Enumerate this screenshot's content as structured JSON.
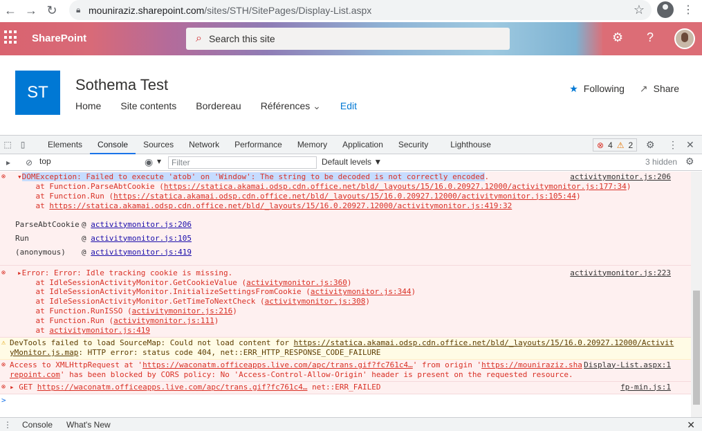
{
  "browser": {
    "url_host": "mouniraziz.sharepoint.com",
    "url_path": "/sites/STH/SitePages/Display-List.aspx",
    "back_icon": "←",
    "forward_icon": "→",
    "reload_icon": "↻",
    "star_icon": "☆",
    "menu_icon": "⋮"
  },
  "suitebar": {
    "brand": "SharePoint",
    "search_placeholder": "Search this site",
    "settings_icon": "⚙",
    "help_icon": "?"
  },
  "site": {
    "logo_text": "ST",
    "title": "Sothema Test",
    "nav": [
      "Home",
      "Site contents",
      "Bordereau",
      "Références",
      "Edit"
    ],
    "following_label": "Following",
    "share_label": "Share"
  },
  "devtools": {
    "tabs": [
      "Elements",
      "Console",
      "Sources",
      "Network",
      "Performance",
      "Memory",
      "Application",
      "Security",
      "Lighthouse"
    ],
    "active_tab": "Console",
    "error_count": "4",
    "warning_count": "2",
    "context": "top",
    "filter_placeholder": "Filter",
    "levels": "Default levels ▼",
    "hidden": "3 hidden",
    "drawer_tabs": [
      "Console",
      "What's New"
    ]
  },
  "console": {
    "m1": {
      "head_pre": "",
      "head_selected": "DOMException: Failed to execute 'atob' on 'Window': The string to be decoded is not correctly encoded",
      "head_post": ".",
      "source": "activitymonitor.js:206",
      "s1_pre": "    at Function.ParseAbtCookie (",
      "s1_link": "https://statica.akamai.odsp.cdn.office.net/bld/_layouts/15/16.0.20927.12000/activitymonitor.js:177:34",
      "s1_post": ")",
      "s2_pre": "    at Function.Run (",
      "s2_link": "https://statica.akamai.odsp.cdn.office.net/bld/_layouts/15/16.0.20927.12000/activitymonitor.js:105:44",
      "s2_post": ")",
      "s3_pre": "    at ",
      "s3_link": "https://statica.akamai.odsp.cdn.office.net/bld/_layouts/15/16.0.20927.12000/activitymonitor.js:419:32",
      "stack_rows": [
        {
          "fn": "ParseAbtCookie",
          "at": "@ ",
          "link": "activitymonitor.js:206"
        },
        {
          "fn": "Run",
          "at": "@ ",
          "link": "activitymonitor.js:105"
        },
        {
          "fn": "(anonymous)",
          "at": "@ ",
          "link": "activitymonitor.js:419"
        }
      ]
    },
    "m2": {
      "head": "Error: Error: Idle tracking cookie is missing.",
      "source": "activitymonitor.js:223",
      "lines": [
        {
          "pre": "    at IdleSessionActivityMonitor.GetCookieValue (",
          "link": "activitymonitor.js:360",
          "post": ")"
        },
        {
          "pre": "    at IdleSessionActivityMonitor.InitializeSettingsFromCookie (",
          "link": "activitymonitor.js:344",
          "post": ")"
        },
        {
          "pre": "    at IdleSessionActivityMonitor.GetTimeToNextCheck (",
          "link": "activitymonitor.js:308",
          "post": ")"
        },
        {
          "pre": "    at Function.RunISSO (",
          "link": "activitymonitor.js:216",
          "post": ")"
        },
        {
          "pre": "    at Function.Run (",
          "link": "activitymonitor.js:111",
          "post": ")"
        },
        {
          "pre": "    at ",
          "link": "activitymonitor.js:419",
          "post": ""
        }
      ]
    },
    "m3": {
      "l1_pre": "DevTools failed to load SourceMap: Could not load content for ",
      "l1_link": "https://statica.akamai.odsp.cdn.office.net/bld/_layouts/15/16.0.20927.12000/Activit",
      "l2_link": "yMonitor.js.map",
      "l2_post": ": HTTP error: status code 404, net::ERR_HTTP_RESPONSE_CODE_FAILURE"
    },
    "m4": {
      "l1_pre": "Access to XMLHttpRequest at '",
      "l1_link": "https://waconatm.officeapps.live.com/apc/trans.gif?fc761c4…",
      "l1_mid": "' from origin '",
      "l1_link2": "https://mouniraziz.sha",
      "l2_link": "repoint.com",
      "l2_post": "' has been blocked by CORS policy: No 'Access-Control-Allow-Origin' header is present on the requested resource.",
      "source": "Display-List.aspx:1"
    },
    "m5": {
      "pre": "GET ",
      "link": "https://waconatm.officeapps.live.com/apc/trans.gif?fc761c4…",
      "post": " net::ERR_FAILED",
      "source": "fp-min.js:1"
    },
    "prompt": ">"
  }
}
